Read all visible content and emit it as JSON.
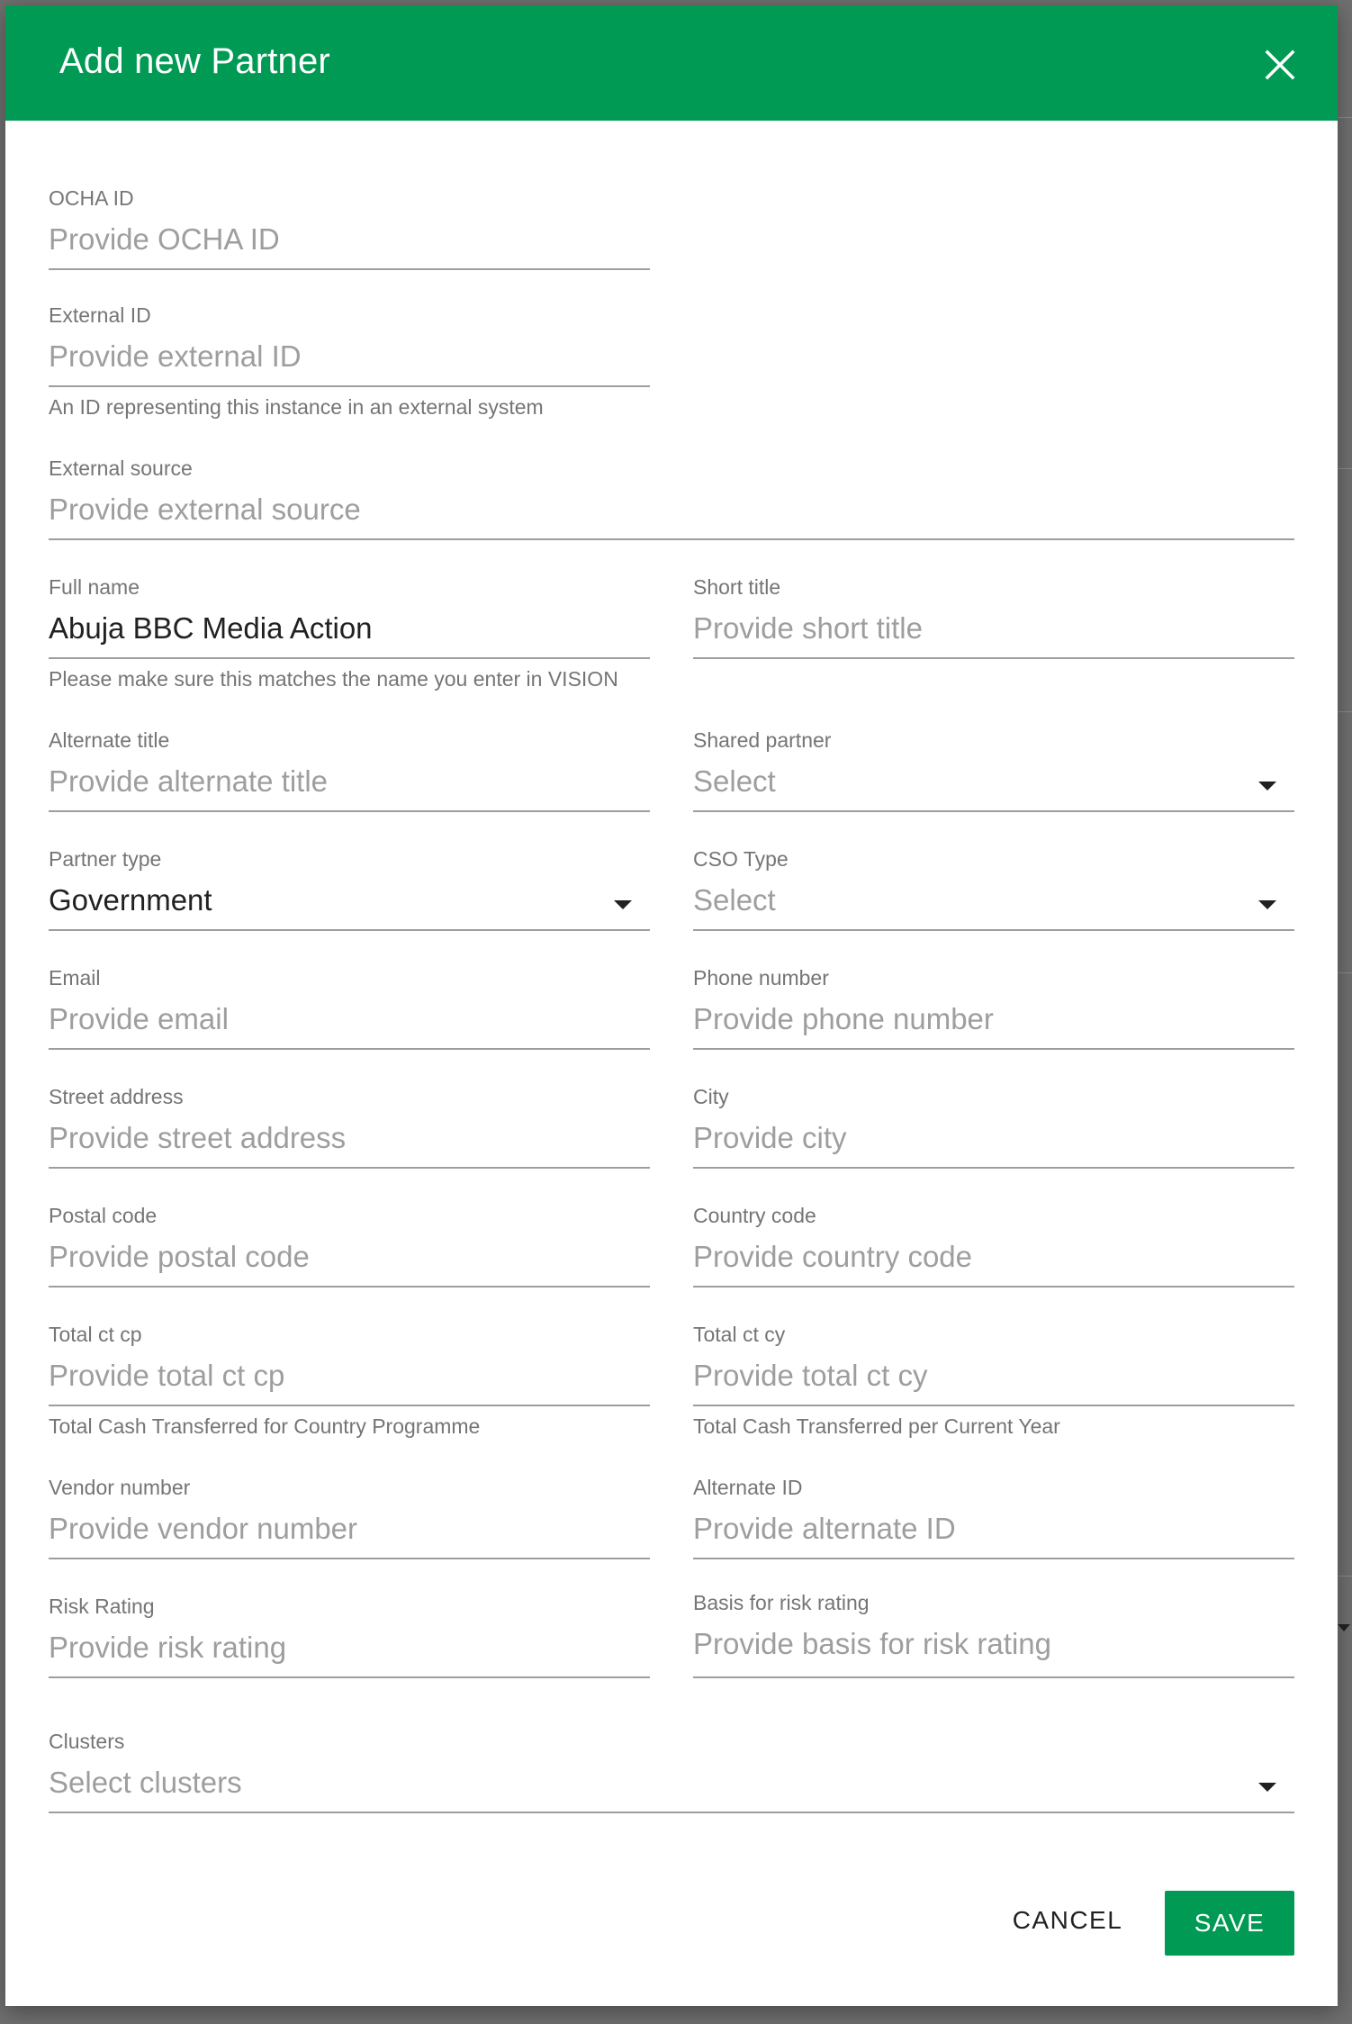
{
  "dialog": {
    "title": "Add new Partner",
    "close_icon": "close-icon",
    "accent_color": "#009a54"
  },
  "fields": {
    "ocha_id": {
      "label": "OCHA ID",
      "placeholder": "Provide OCHA ID",
      "value": ""
    },
    "external_id": {
      "label": "External ID",
      "placeholder": "Provide external ID",
      "value": "",
      "hint": "An ID representing this instance in an external system"
    },
    "external_source": {
      "label": "External source",
      "placeholder": "Provide external source",
      "value": ""
    },
    "full_name": {
      "label": "Full name",
      "placeholder": "",
      "value": "Abuja BBC Media Action",
      "hint": "Please make sure this matches the name you enter in VISION"
    },
    "short_title": {
      "label": "Short title",
      "placeholder": "Provide short title",
      "value": ""
    },
    "alternate_title": {
      "label": "Alternate title",
      "placeholder": "Provide alternate title",
      "value": ""
    },
    "shared_partner": {
      "label": "Shared partner",
      "display": "Select"
    },
    "partner_type": {
      "label": "Partner type",
      "display": "Government"
    },
    "cso_type": {
      "label": "CSO Type",
      "display": "Select"
    },
    "email": {
      "label": "Email",
      "placeholder": "Provide email",
      "value": ""
    },
    "phone_number": {
      "label": "Phone number",
      "placeholder": "Provide phone number",
      "value": ""
    },
    "street_address": {
      "label": "Street address",
      "placeholder": "Provide street address",
      "value": ""
    },
    "city": {
      "label": "City",
      "placeholder": "Provide city",
      "value": ""
    },
    "postal_code": {
      "label": "Postal code",
      "placeholder": "Provide postal code",
      "value": ""
    },
    "country_code": {
      "label": "Country code",
      "placeholder": "Provide country code",
      "value": ""
    },
    "total_ct_cp": {
      "label": "Total ct cp",
      "placeholder": "Provide total ct cp",
      "value": "",
      "hint": "Total Cash Transferred for Country Programme"
    },
    "total_ct_cy": {
      "label": "Total ct cy",
      "placeholder": "Provide total ct cy",
      "value": "",
      "hint": "Total Cash Transferred per Current Year"
    },
    "vendor_number": {
      "label": "Vendor number",
      "placeholder": "Provide vendor number",
      "value": ""
    },
    "alternate_id": {
      "label": "Alternate ID",
      "placeholder": "Provide alternate ID",
      "value": ""
    },
    "risk_rating": {
      "label": "Risk Rating",
      "placeholder": "Provide risk rating",
      "value": ""
    },
    "basis_risk_rating": {
      "label": "Basis for risk rating",
      "placeholder": "Provide basis for risk rating",
      "value": ""
    },
    "clusters": {
      "label": "Clusters",
      "display": "Select clusters"
    }
  },
  "actions": {
    "cancel_label": "CANCEL",
    "save_label": "SAVE"
  }
}
